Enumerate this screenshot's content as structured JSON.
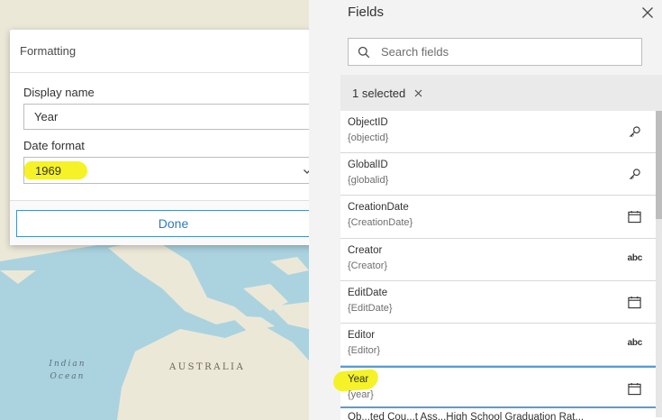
{
  "map": {
    "labels": {
      "ocean": "Indian\nOcean",
      "country": "AUSTRALIA"
    },
    "colors": {
      "water": "#aad3df",
      "land": "#ece8d8"
    }
  },
  "dialog": {
    "title": "Formatting",
    "display_name_label": "Display name",
    "display_name_value": "Year",
    "date_format_label": "Date format",
    "date_format_value": "1969",
    "done_label": "Done"
  },
  "panel": {
    "title": "Fields",
    "search_placeholder": "Search fields",
    "selected_chip": "1 selected",
    "fields": [
      {
        "name": "ObjectID",
        "key": "{objectid}",
        "icon": "key-icon"
      },
      {
        "name": "GlobalID",
        "key": "{globalid}",
        "icon": "key-icon"
      },
      {
        "name": "CreationDate",
        "key": "{CreationDate}",
        "icon": "calendar-icon"
      },
      {
        "name": "Creator",
        "key": "{Creator}",
        "icon": "abc"
      },
      {
        "name": "EditDate",
        "key": "{EditDate}",
        "icon": "calendar-icon"
      },
      {
        "name": "Editor",
        "key": "{Editor}",
        "icon": "abc"
      },
      {
        "name": "Year",
        "key": "{year}",
        "icon": "calendar-icon"
      },
      {
        "name": "Ob...ted Cou...t Ass...High School Graduation Rat..."
      }
    ],
    "accent": "#5a9bd4",
    "highlight": "#f4f10f"
  }
}
